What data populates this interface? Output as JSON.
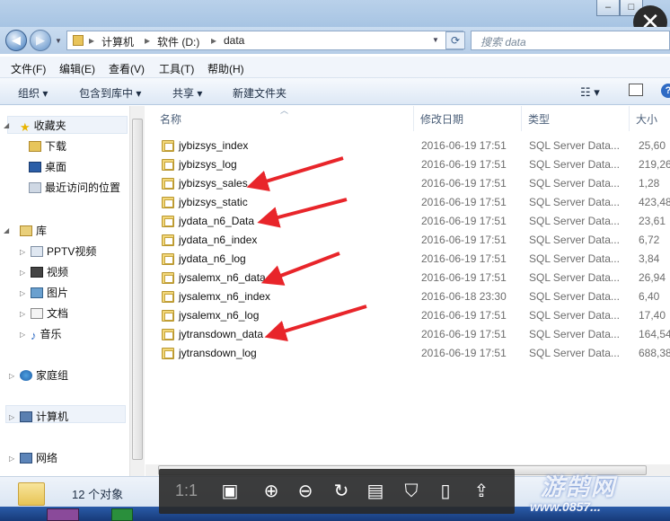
{
  "address": {
    "segments": [
      "计算机",
      "软件 (D:)",
      "data"
    ],
    "search_placeholder": "搜索 data"
  },
  "menu": [
    "文件(F)",
    "编辑(E)",
    "查看(V)",
    "工具(T)",
    "帮助(H)"
  ],
  "toolbar": {
    "organize": "组织 ▾",
    "include_library": "包含到库中 ▾",
    "share": "共享 ▾",
    "new_folder": "新建文件夹"
  },
  "nav": {
    "favorites": "收藏夹",
    "downloads": "下载",
    "desktop": "桌面",
    "recent": "最近访问的位置",
    "libraries": "库",
    "pptv": "PPTV视频",
    "videos": "视频",
    "pictures": "图片",
    "documents": "文档",
    "music": "音乐",
    "homegroup": "家庭组",
    "computer": "计算机",
    "network": "网络"
  },
  "columns": {
    "name": "名称",
    "date": "修改日期",
    "type": "类型",
    "size": "大小"
  },
  "files": [
    {
      "name": "jybizsys_index",
      "date": "2016-06-19 17:51",
      "type": "SQL Server Data...",
      "size": "25,60"
    },
    {
      "name": "jybizsys_log",
      "date": "2016-06-19 17:51",
      "type": "SQL Server Data...",
      "size": "219,26"
    },
    {
      "name": "jybizsys_sales",
      "date": "2016-06-19 17:51",
      "type": "SQL Server Data...",
      "size": "1,28"
    },
    {
      "name": "jybizsys_static",
      "date": "2016-06-19 17:51",
      "type": "SQL Server Data...",
      "size": "423,48"
    },
    {
      "name": "jydata_n6_Data",
      "date": "2016-06-19 17:51",
      "type": "SQL Server Data...",
      "size": "23,61"
    },
    {
      "name": "jydata_n6_index",
      "date": "2016-06-19 17:51",
      "type": "SQL Server Data...",
      "size": "6,72"
    },
    {
      "name": "jydata_n6_log",
      "date": "2016-06-19 17:51",
      "type": "SQL Server Data...",
      "size": "3,84"
    },
    {
      "name": "jysalemx_n6_data",
      "date": "2016-06-19 17:51",
      "type": "SQL Server Data...",
      "size": "26,94"
    },
    {
      "name": "jysalemx_n6_index",
      "date": "2016-06-18 23:30",
      "type": "SQL Server Data...",
      "size": "6,40"
    },
    {
      "name": "jysalemx_n6_log",
      "date": "2016-06-19 17:51",
      "type": "SQL Server Data...",
      "size": "17,40"
    },
    {
      "name": "jytransdown_data",
      "date": "2016-06-19 17:51",
      "type": "SQL Server Data...",
      "size": "164,54"
    },
    {
      "name": "jytransdown_log",
      "date": "2016-06-19 17:51",
      "type": "SQL Server Data...",
      "size": "688,38"
    }
  ],
  "status": {
    "count": "12 个对象"
  },
  "viewer": {
    "ratio": "1:1"
  },
  "watermark": {
    "main": "游鹄网",
    "url": "www.0857..."
  },
  "colors": {
    "accent_red": "#e8252a",
    "window_blue": "#b9d1ea"
  }
}
